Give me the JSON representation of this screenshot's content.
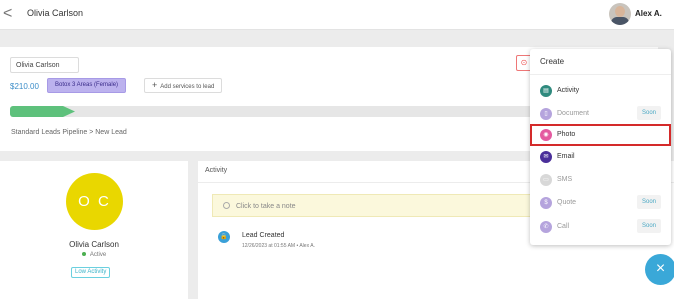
{
  "header": {
    "back_glyph": "<",
    "title": "Olivia Carlson",
    "user_name": "Alex A."
  },
  "lead": {
    "name_value": "Olivia  Carlson",
    "price": "$210.00",
    "service_tag": "Botox 3 Areas (Female)",
    "add_service_icon": "+",
    "add_service_label": "Add services to lead",
    "stage_icon": "⊙",
    "progress_fraction": 0.08,
    "breadcrumb": "Standard Leads Pipeline  >  New Lead"
  },
  "profile": {
    "initials": "O C",
    "name": "Olivia Carlson",
    "status": "Active",
    "badge": "Low Activity",
    "avatar_color": "#e9d700"
  },
  "activity": {
    "header": "Activity",
    "note_placeholder": "Click to take a note",
    "events": [
      {
        "icon": "lock-icon",
        "glyph": "🔒",
        "title": "Lead Created",
        "meta": "12/26/2023 at 01:55 AM  •  Alex A."
      }
    ]
  },
  "create_menu": {
    "title": "Create",
    "items": [
      {
        "label": "Activity",
        "icon": "calendar-icon",
        "glyph": "▤",
        "color": "#2f8a7e",
        "enabled": true,
        "badge": ""
      },
      {
        "label": "Document",
        "icon": "document-icon",
        "glyph": "▯",
        "color": "#b5a4dd",
        "enabled": false,
        "badge": "Soon"
      },
      {
        "label": "Photo",
        "icon": "camera-icon",
        "glyph": "◉",
        "color": "#e45aa0",
        "enabled": true,
        "badge": "",
        "selected": true
      },
      {
        "label": "Email",
        "icon": "envelope-icon",
        "glyph": "✉",
        "color": "#4a2f9a",
        "enabled": true,
        "badge": ""
      },
      {
        "label": "SMS",
        "icon": "chat-icon",
        "glyph": "▭",
        "color": "#d8d8d8",
        "enabled": false,
        "badge": ""
      },
      {
        "label": "Quote",
        "icon": "quote-icon",
        "glyph": "$",
        "color": "#b5a4dd",
        "enabled": false,
        "badge": "Soon"
      },
      {
        "label": "Call",
        "icon": "phone-icon",
        "glyph": "✆",
        "color": "#b5a4dd",
        "enabled": false,
        "badge": "Soon"
      }
    ]
  },
  "fab": {
    "glyph": "×",
    "icon": "close-icon"
  },
  "colors": {
    "accent": "#3aa8d8",
    "success": "#5ec17c",
    "highlight": "#d42a2a"
  }
}
